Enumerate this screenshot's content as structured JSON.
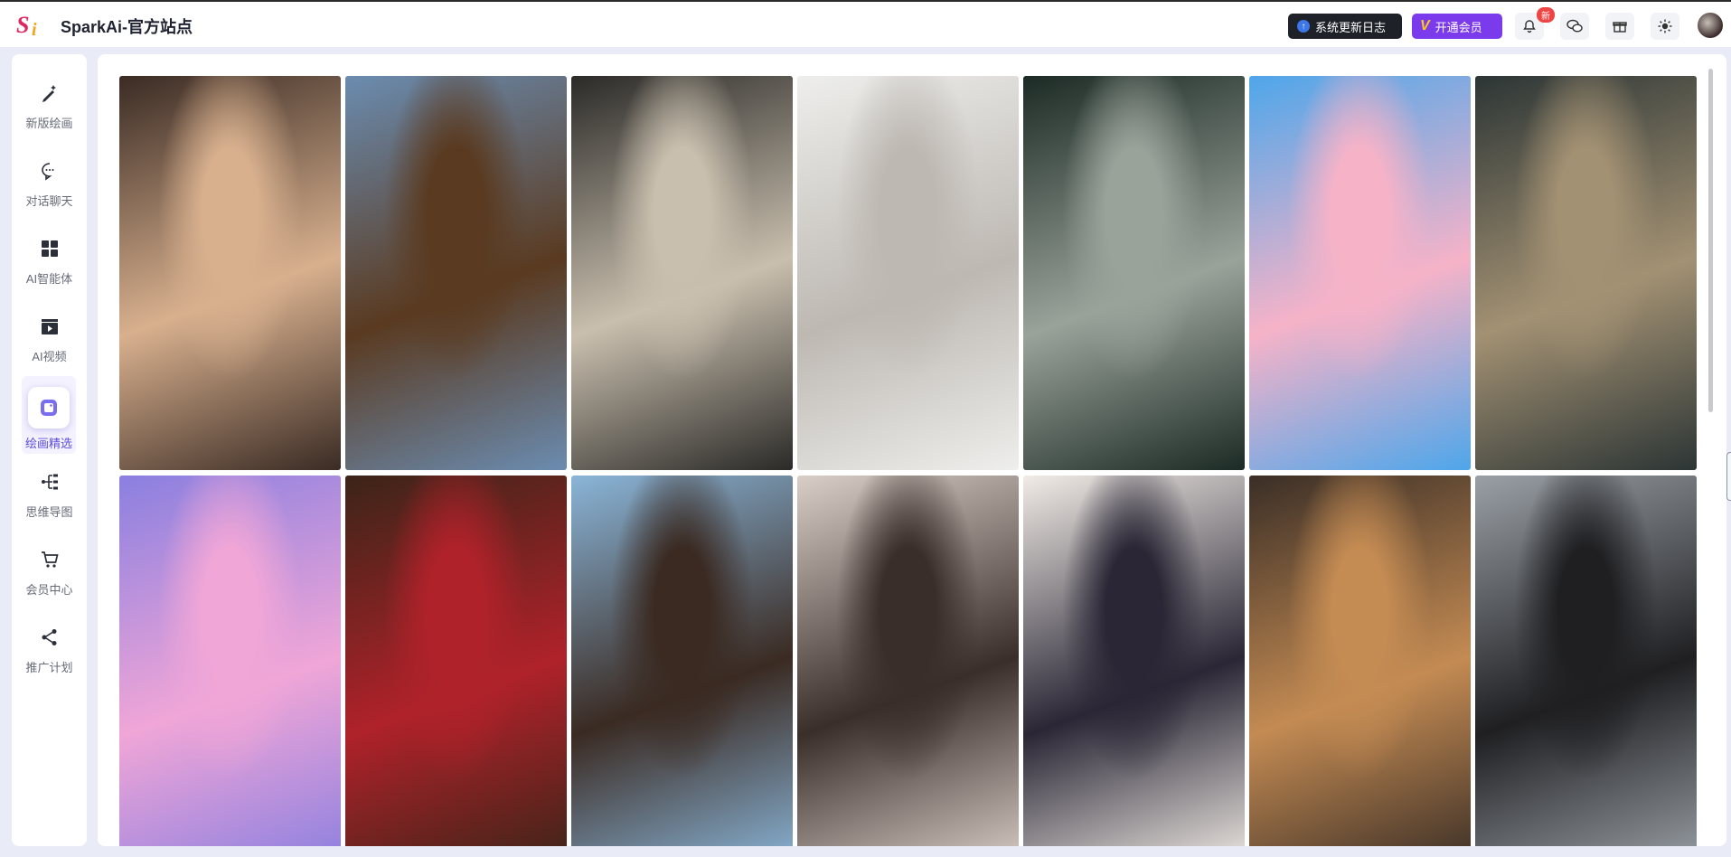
{
  "header": {
    "brand": "SparkAi-官方站点",
    "changelog_label": "系统更新日志",
    "vip_label": "开通会员",
    "new_badge": "新",
    "icons": [
      "bell-icon",
      "wechat-icon",
      "gift-icon",
      "sun-icon"
    ]
  },
  "sidebar": {
    "items": [
      {
        "label": "新版绘画",
        "icon": "pen-sparkle-icon"
      },
      {
        "label": "对话聊天",
        "icon": "chat-bubble-icon"
      },
      {
        "label": "AI智能体",
        "icon": "grid-apps-icon"
      },
      {
        "label": "AI视频",
        "icon": "clapperboard-icon"
      },
      {
        "label": "绘画精选",
        "icon": "image-gallery-icon",
        "active": true
      },
      {
        "label": "思维导图",
        "icon": "mindmap-icon"
      },
      {
        "label": "会员中心",
        "icon": "cart-icon"
      },
      {
        "label": "推广计划",
        "icon": "share-icon"
      }
    ]
  },
  "gallery": {
    "images": [
      {
        "subject": "portrait-woman-sunset",
        "colors": [
          "#3a2b24",
          "#d8b08e"
        ]
      },
      {
        "subject": "horse-galloping",
        "colors": [
          "#6b8cb0",
          "#5a3a20"
        ]
      },
      {
        "subject": "loft-interior",
        "colors": [
          "#2b2a28",
          "#c9bfae"
        ]
      },
      {
        "subject": "woman-white-veil",
        "colors": [
          "#eeeeec",
          "#bdb8b2"
        ]
      },
      {
        "subject": "woman-dark-water",
        "colors": [
          "#1c2a25",
          "#9aa39a"
        ]
      },
      {
        "subject": "anime-girl-sunflowers",
        "colors": [
          "#4ea6ea",
          "#f6b3c8"
        ]
      },
      {
        "subject": "woman-window-light",
        "colors": [
          "#2c3535",
          "#a39173"
        ]
      },
      {
        "subject": "rainbow-hair-girl",
        "colors": [
          "#8a7fe0",
          "#f0a6d7"
        ]
      },
      {
        "subject": "woman-red-christmas",
        "colors": [
          "#3b2418",
          "#b0222a"
        ]
      },
      {
        "subject": "woman-beach-wind",
        "colors": [
          "#8ab5d8",
          "#3a2a22"
        ]
      },
      {
        "subject": "woman-ponytail-branches",
        "colors": [
          "#d9cfc8",
          "#3a2e2a"
        ]
      },
      {
        "subject": "anime-demon-girl-flowers",
        "colors": [
          "#f1ece6",
          "#2a2635"
        ]
      },
      {
        "subject": "woman-glasses-cafe",
        "colors": [
          "#3a2e26",
          "#c48b53"
        ]
      },
      {
        "subject": "woman-black-dress-shadows",
        "colors": [
          "#9aa0a6",
          "#1f1f22"
        ]
      }
    ]
  }
}
